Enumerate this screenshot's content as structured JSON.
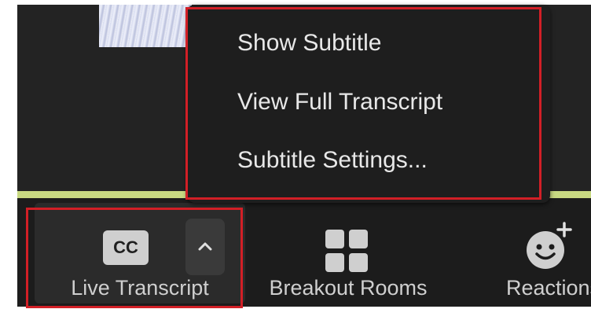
{
  "menu": {
    "items": [
      {
        "label": "Show Subtitle"
      },
      {
        "label": "View Full Transcript"
      },
      {
        "label": "Subtitle Settings..."
      }
    ]
  },
  "toolbar": {
    "live_transcript": {
      "label": "Live Transcript",
      "icon_text": "CC",
      "icon": "cc-icon",
      "options_icon": "chevron-up-icon"
    },
    "breakout_rooms": {
      "label": "Breakout Rooms",
      "icon": "grid-icon"
    },
    "reactions": {
      "label": "Reactions",
      "icon": "add-reaction-icon"
    }
  },
  "colors": {
    "highlight": "#d21f26",
    "divider_bar": "#c8d982",
    "toolbar_bg": "#1c1c1c",
    "menu_bg": "#1e1e1e"
  }
}
